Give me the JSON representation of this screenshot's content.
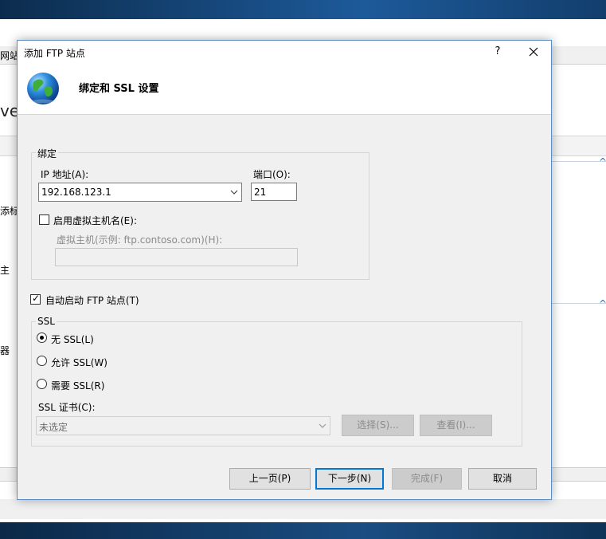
{
  "background": {
    "left_texts": [
      "网站",
      "vel",
      "添标",
      "主",
      "器"
    ]
  },
  "dialog": {
    "title": "添加 FTP 站点",
    "help": "?",
    "close": "✕",
    "header_title": "绑定和 SSL 设置",
    "binding": {
      "legend": "绑定",
      "ip_label": "IP 地址(A):",
      "ip_value": "192.168.123.1",
      "port_label": "端口(O):",
      "port_value": "21",
      "virtual_host_check_label": "启用虚拟主机名(E):",
      "virtual_host_checked": false,
      "virtual_host_label": "虚拟主机(示例: ftp.contoso.com)(H):",
      "virtual_host_value": ""
    },
    "auto_start": {
      "label": "自动启动 FTP 站点(T)",
      "checked": true
    },
    "ssl": {
      "legend": "SSL",
      "options": [
        {
          "label": "无 SSL(L)",
          "selected": true
        },
        {
          "label": "允许 SSL(W)",
          "selected": false
        },
        {
          "label": "需要 SSL(R)",
          "selected": false
        }
      ],
      "cert_label": "SSL 证书(C):",
      "cert_value": "未选定",
      "select_button": "选择(S)...",
      "view_button": "查看(I)..."
    },
    "buttons": {
      "prev": "上一页(P)",
      "next": "下一步(N)",
      "finish": "完成(F)",
      "cancel": "取消"
    }
  }
}
